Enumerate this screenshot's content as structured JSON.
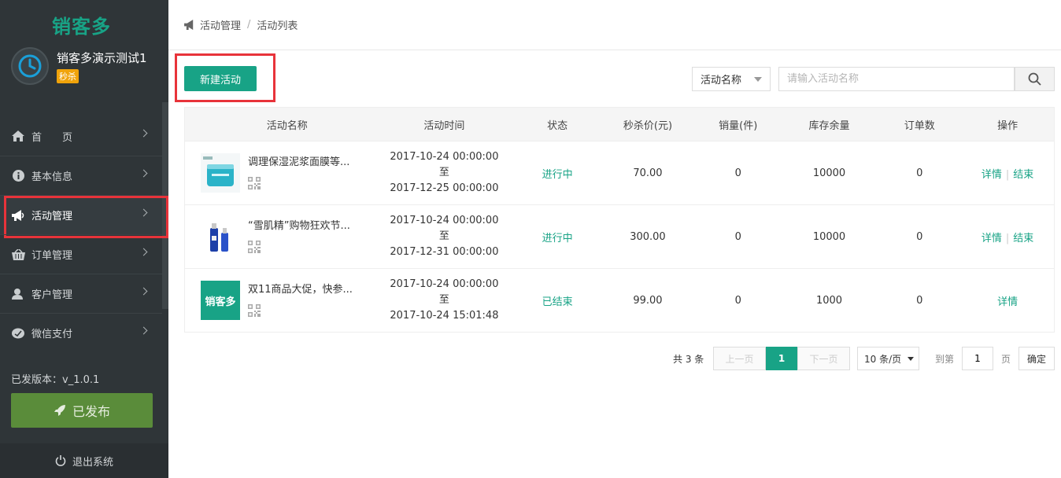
{
  "sidebar": {
    "logo": "销客多",
    "shop_name": "销客多演示测试1",
    "shop_badge": "秒杀",
    "items": [
      {
        "label": "首　　页",
        "icon": "home-icon"
      },
      {
        "label": "基本信息",
        "icon": "info-icon"
      },
      {
        "label": "活动管理",
        "icon": "megaphone-icon"
      },
      {
        "label": "订单管理",
        "icon": "basket-icon"
      },
      {
        "label": "客户管理",
        "icon": "user-icon"
      },
      {
        "label": "微信支付",
        "icon": "wechat-icon"
      }
    ],
    "version": "已发版本：v_1.0.1",
    "publish_label": "已发布",
    "logout_label": "退出系统"
  },
  "breadcrumb": {
    "root": "活动管理",
    "separator": "/",
    "current": "活动列表"
  },
  "toolbar": {
    "new_label": "新建活动",
    "search_field": "活动名称",
    "search_placeholder": "请输入活动名称"
  },
  "table": {
    "headers": [
      "活动名称",
      "活动时间",
      "状态",
      "秒杀价(元)",
      "销量(件)",
      "库存余量",
      "订单数",
      "操作"
    ],
    "rows": [
      {
        "name": "调理保湿泥浆面膜等...",
        "start": "2017-10-24 00:00:00",
        "to": "至",
        "end": "2017-12-25 00:00:00",
        "status": "进行中",
        "price": "70.00",
        "sales": "0",
        "stock": "10000",
        "orders": "0",
        "op_detail": "详情",
        "op_sep": "|",
        "op_end": "结束"
      },
      {
        "name": "“雪肌精”购物狂欢节...",
        "start": "2017-10-24 00:00:00",
        "to": "至",
        "end": "2017-12-31 00:00:00",
        "status": "进行中",
        "price": "300.00",
        "sales": "0",
        "stock": "10000",
        "orders": "0",
        "op_detail": "详情",
        "op_sep": "|",
        "op_end": "结束"
      },
      {
        "name": "双11商品大促，快参...",
        "start": "2017-10-24 00:00:00",
        "to": "至",
        "end": "2017-10-24 15:01:48",
        "status": "已结束",
        "price": "99.00",
        "sales": "0",
        "stock": "1000",
        "orders": "0",
        "op_detail": "详情"
      }
    ],
    "thumb3_text": "销客多"
  },
  "pagination": {
    "total": "共 3 条",
    "prev": "上一页",
    "current": "1",
    "next": "下一页",
    "page_size": "10 条/页",
    "goto_label": "到第",
    "goto_value": "1",
    "page_label": "页",
    "confirm": "确定"
  },
  "colors": {
    "accent": "#18a386",
    "sidebar_bg": "#2f3538",
    "publish": "#5a8c3a",
    "highlight": "#e8333a",
    "badge": "#f0a30a"
  }
}
